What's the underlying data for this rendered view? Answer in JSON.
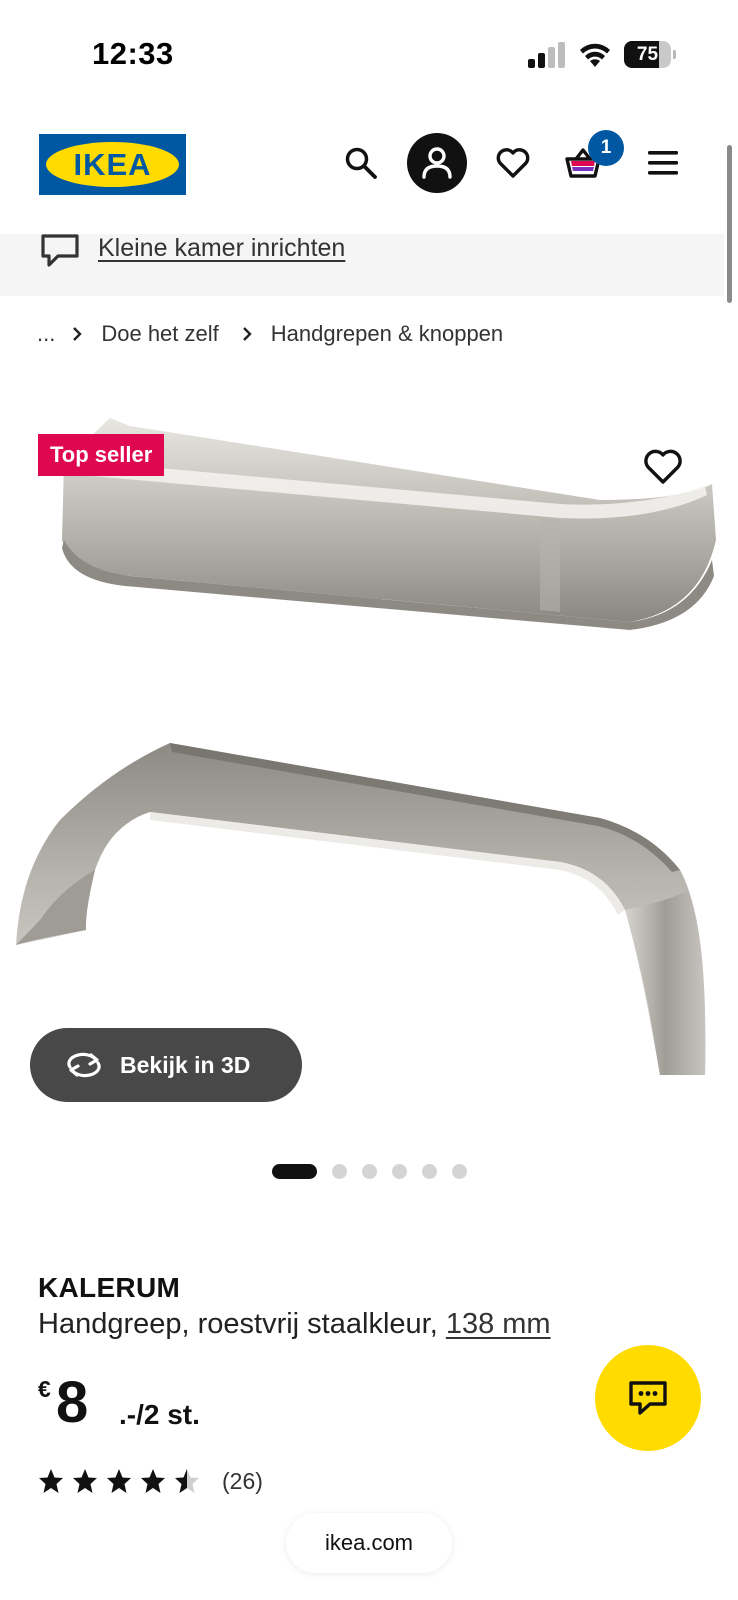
{
  "status_bar": {
    "time": "12:33",
    "battery_level": "75",
    "battery_fraction": 0.75,
    "icons": [
      "signal-icon",
      "wifi-icon",
      "battery-icon"
    ]
  },
  "header": {
    "logo_text": "IKEA",
    "icons": [
      "search-icon",
      "account-icon",
      "heart-icon",
      "cart-icon",
      "menu-icon"
    ],
    "cart_count": "1",
    "colors": {
      "brand_blue": "#0058a3",
      "brand_yellow": "#ffdb00"
    }
  },
  "banner": {
    "icon": "chat-bubble-icon",
    "link": "Kleine kamer inrichten"
  },
  "breadcrumb": {
    "items": [
      "...",
      "Doe het zelf",
      "Handgrepen & knoppen"
    ]
  },
  "gallery": {
    "badge": "Top seller",
    "badge_color": "#e00751",
    "view_3d_label": "Bekijk in 3D",
    "image_count": 6,
    "active_index": 0
  },
  "product": {
    "name": "KALERUM",
    "description": "Handgreep, roestvrij staalkleur,",
    "size": "138 mm",
    "price": {
      "currency": "€",
      "integer": "8",
      "suffix": ".-/2 st."
    },
    "rating": {
      "value": 4.5,
      "max": 5,
      "count": "(26)"
    }
  },
  "chat": {
    "icon": "chat-icon",
    "color": "#ffdb00"
  },
  "browser": {
    "url": "ikea.com"
  }
}
